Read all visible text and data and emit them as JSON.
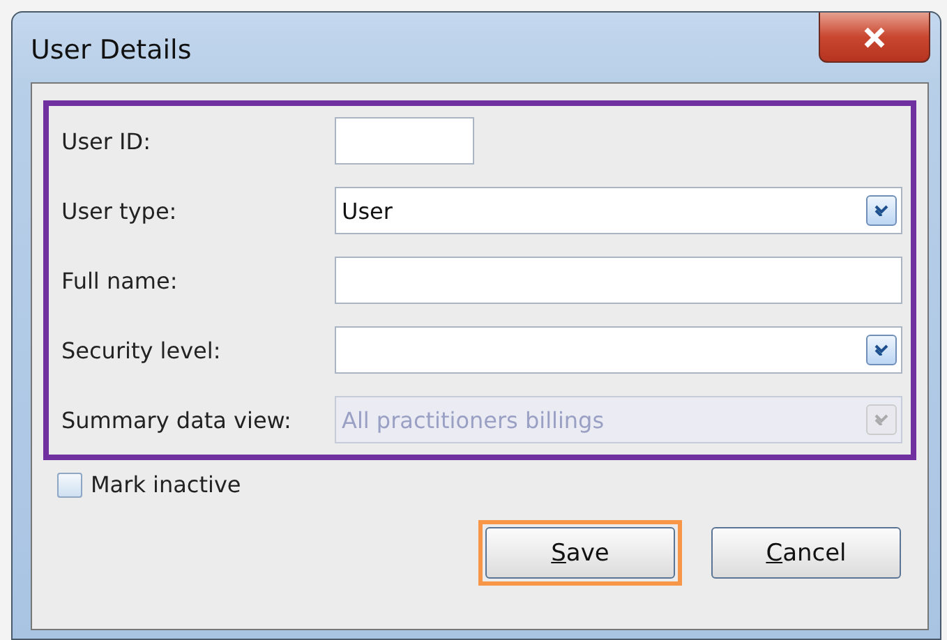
{
  "window": {
    "title": "User Details"
  },
  "form": {
    "highlighted": true,
    "fields": [
      {
        "label": "User ID:",
        "kind": "short_text",
        "disabled": false
      },
      {
        "label": "User type:",
        "kind": "dropdown",
        "value": "User",
        "disabled": false
      },
      {
        "label": "Full name:",
        "kind": "text",
        "disabled": false
      },
      {
        "label": "Security level:",
        "kind": "dropdown",
        "disabled": false
      },
      {
        "label": "Summary data view:",
        "kind": "dropdown",
        "value": "All practitioners billings",
        "disabled": true
      }
    ]
  },
  "mark_inactive": {
    "label": "Mark inactive",
    "checked": false
  },
  "buttons": [
    {
      "label": "Save",
      "highlighted": true
    },
    {
      "label": "Cancel",
      "highlighted": false
    }
  ]
}
